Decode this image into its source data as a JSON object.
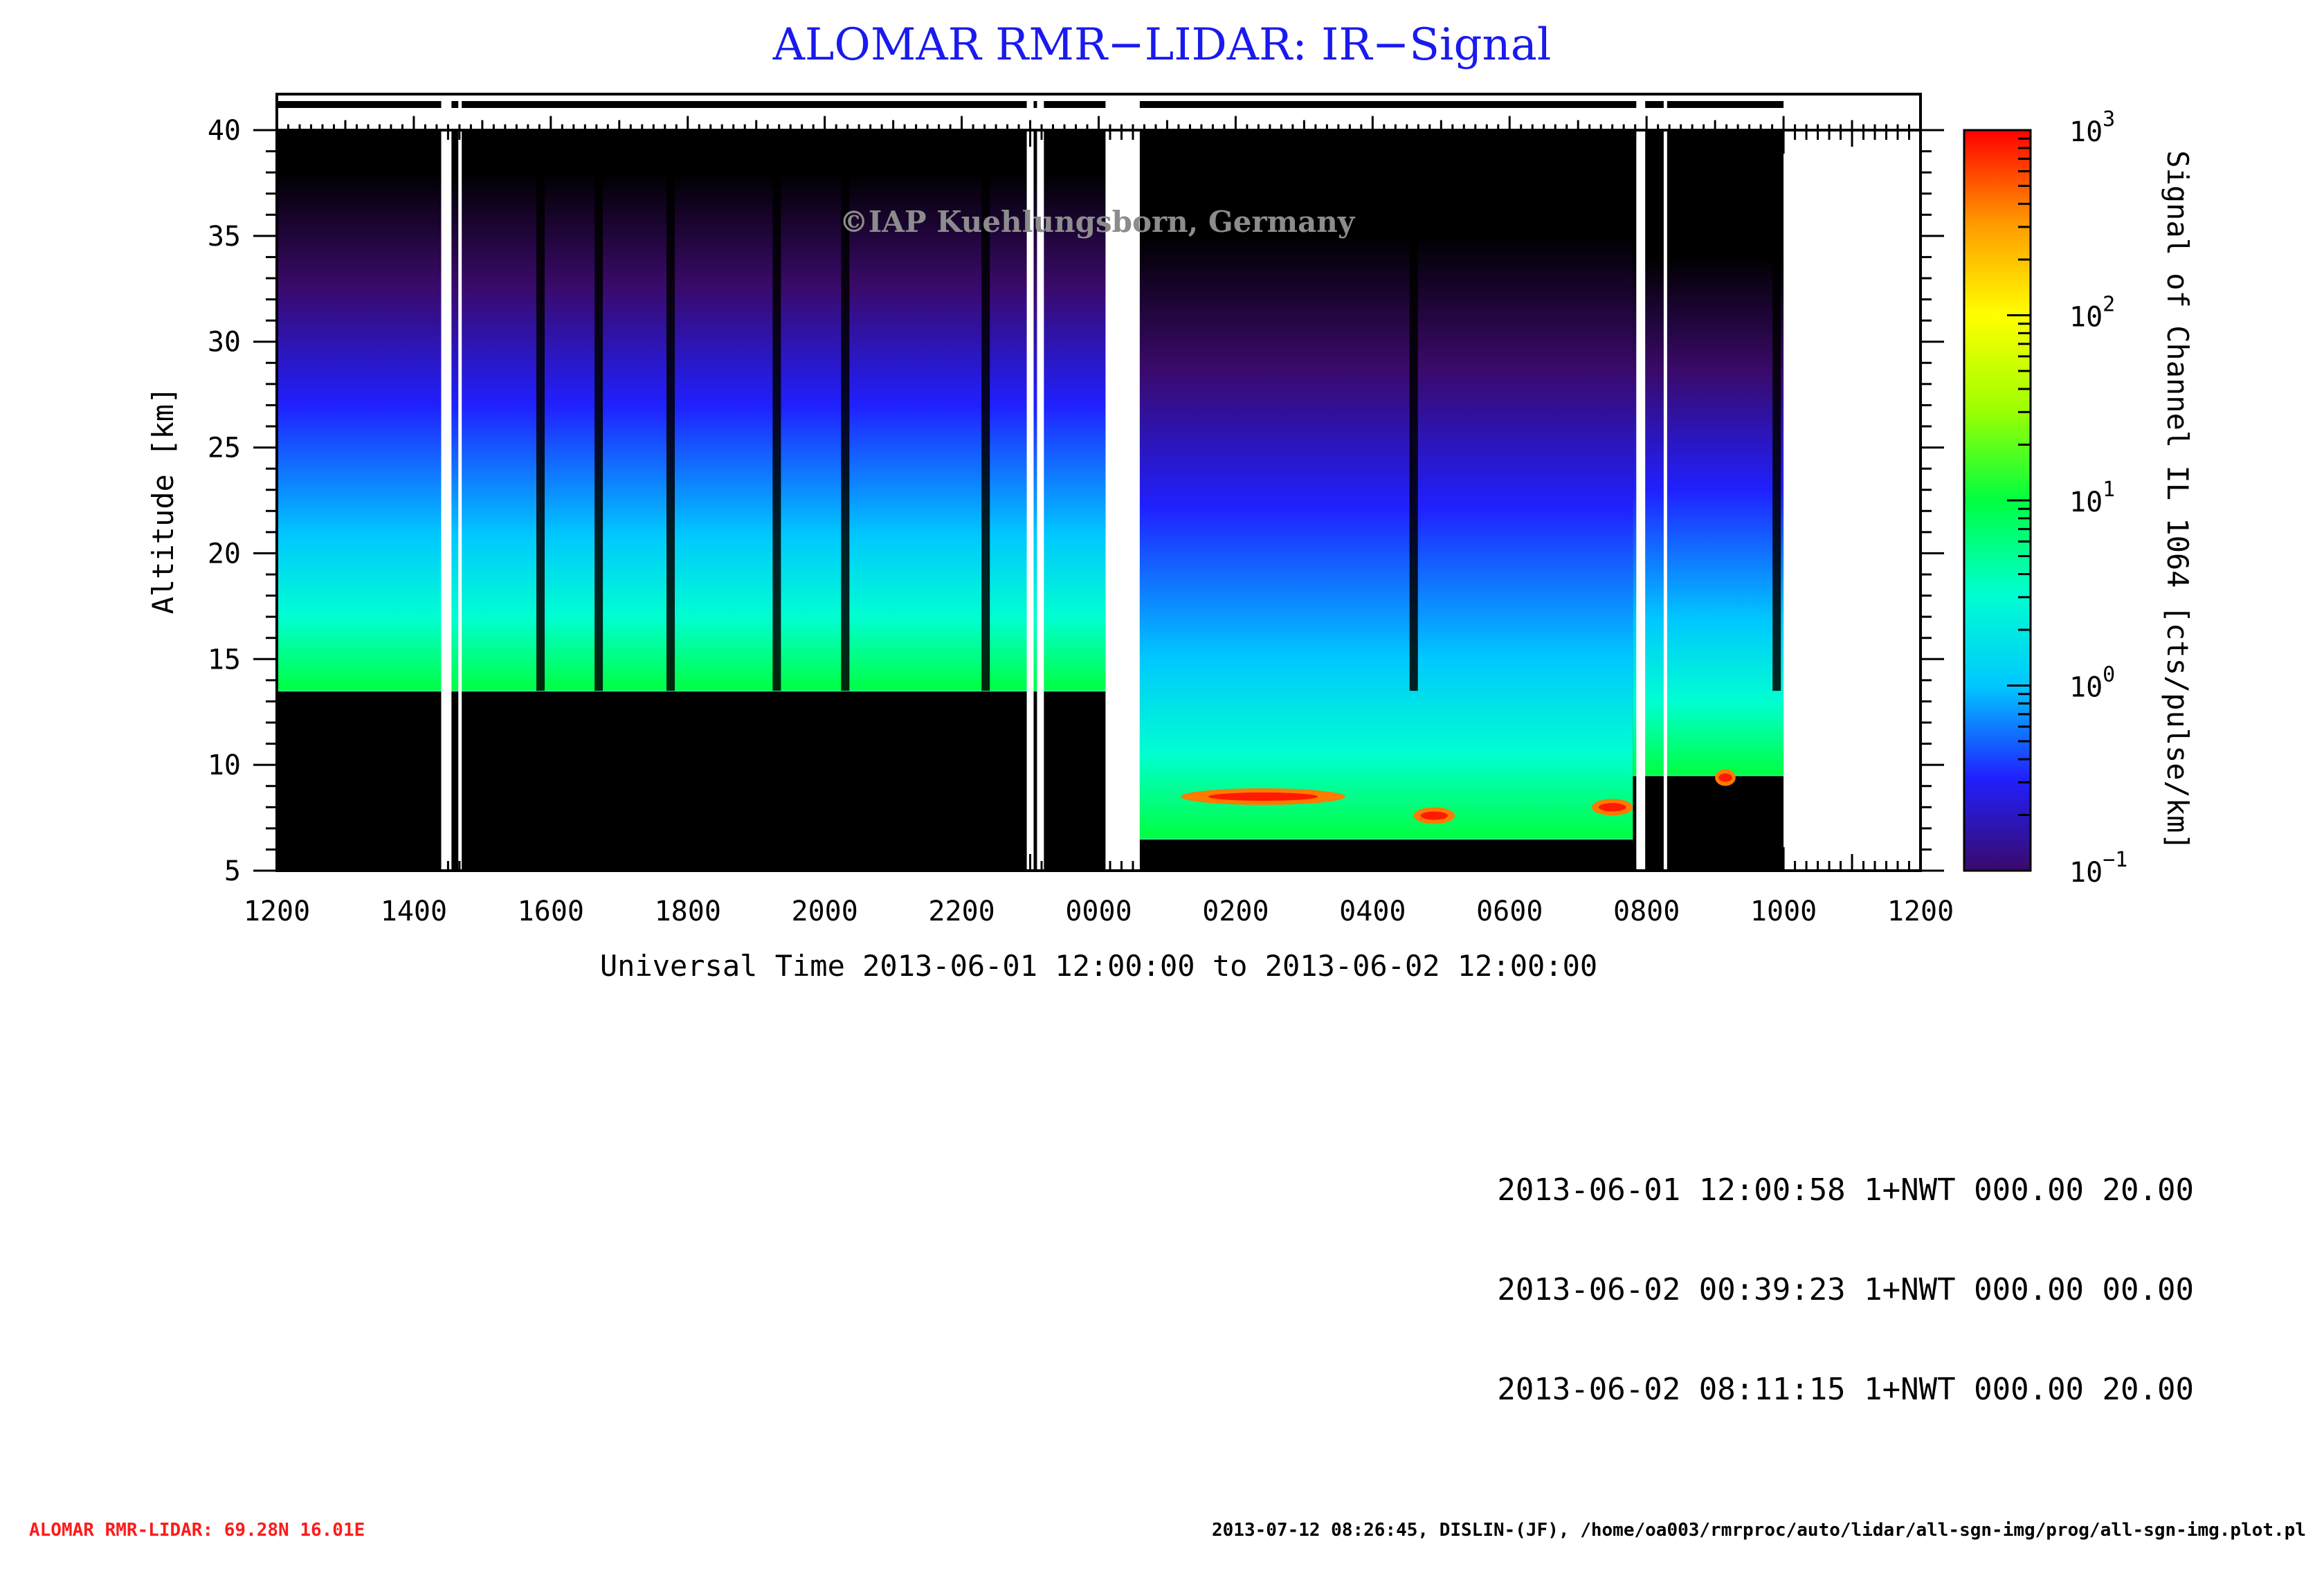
{
  "title": "ALOMAR RMR−LIDAR: IR−Signal",
  "watermark": "©IAP Kuehlungsborn, Germany",
  "info_lines": [
    "2013-06-01 12:00:58 1+NWT 000.00 20.00",
    "2013-06-02 00:39:23 1+NWT 000.00 00.00",
    "2013-06-02 08:11:15 1+NWT 000.00 20.00"
  ],
  "footer": {
    "left": "ALOMAR RMR-LIDAR: 69.28N 16.01E",
    "right": "2013-07-12 08:26:45, DISLIN-(JF), /home/oa003/rmrproc/auto/lidar/all-sgn-img/prog/all-sgn-img.plot.pl"
  },
  "colors": {
    "title": "#1a1aee",
    "footer_left": "#ff1a1a",
    "colormap": [
      "#3a0a6a",
      "#2020ff",
      "#00c8ff",
      "#00ffd0",
      "#00ff40",
      "#a0ff00",
      "#ffff00",
      "#ff9900",
      "#ff0000"
    ]
  },
  "chart_data": {
    "type": "heatmap",
    "title": "ALOMAR RMR−LIDAR: IR−Signal",
    "xlabel": "Universal Time 2013-06-01 12:00:00 to 2013-06-02 12:00:00",
    "ylabel": "Altitude [km]",
    "xlim_hours_ut": [
      12,
      36
    ],
    "x_tick_labels": [
      "1200",
      "1400",
      "1600",
      "1800",
      "2000",
      "2200",
      "0000",
      "0200",
      "0400",
      "0600",
      "0800",
      "1000",
      "1200"
    ],
    "ylim": [
      5,
      40
    ],
    "y_ticks": [
      5,
      10,
      15,
      20,
      25,
      30,
      35,
      40
    ],
    "colorbar": {
      "label": "Signal of Channel IL 1064 [cts/pulse/km]",
      "scale": "log",
      "range": [
        0.1,
        1000
      ],
      "tick_labels": [
        {
          "base": "10",
          "exp": "−1",
          "value": 0.1
        },
        {
          "base": "10",
          "exp": "0",
          "value": 1
        },
        {
          "base": "10",
          "exp": "1",
          "value": 10
        },
        {
          "base": "10",
          "exp": "2",
          "value": 100
        },
        {
          "base": "10",
          "exp": "3",
          "value": 1000
        }
      ]
    },
    "data_gaps_hours": [
      [
        14.4,
        14.55
      ],
      [
        14.65,
        14.7
      ],
      [
        22.95,
        23.05
      ],
      [
        23.1,
        23.2
      ],
      [
        24.1,
        24.6
      ],
      [
        31.85,
        31.98
      ],
      [
        32.25,
        32.3
      ],
      [
        34.0,
        36.0
      ]
    ],
    "segments": [
      {
        "start_hour": 12.0,
        "end_hour": 24.1,
        "lower_altitude_km": 13.5,
        "signal_top_km": 34
      },
      {
        "start_hour": 24.6,
        "end_hour": 31.8,
        "lower_altitude_km": 6.5,
        "signal_top_km": 31
      },
      {
        "start_hour": 31.8,
        "end_hour": 34.0,
        "lower_altitude_km": 9.5,
        "signal_top_km": 30
      }
    ],
    "cloud_events": [
      {
        "start_hour": 25.2,
        "end_hour": 27.6,
        "altitude_km": 8.5,
        "signal": 300
      },
      {
        "start_hour": 28.6,
        "end_hour": 29.2,
        "altitude_km": 7.6,
        "signal": 400
      },
      {
        "start_hour": 31.2,
        "end_hour": 31.8,
        "altitude_km": 8.0,
        "signal": 400
      },
      {
        "start_hour": 33.0,
        "end_hour": 33.3,
        "altitude_km": 9.4,
        "signal": 150
      }
    ],
    "low_signal_columns_hours": [
      15.85,
      16.7,
      17.75,
      19.3,
      20.3,
      22.35,
      28.6,
      33.9
    ]
  }
}
